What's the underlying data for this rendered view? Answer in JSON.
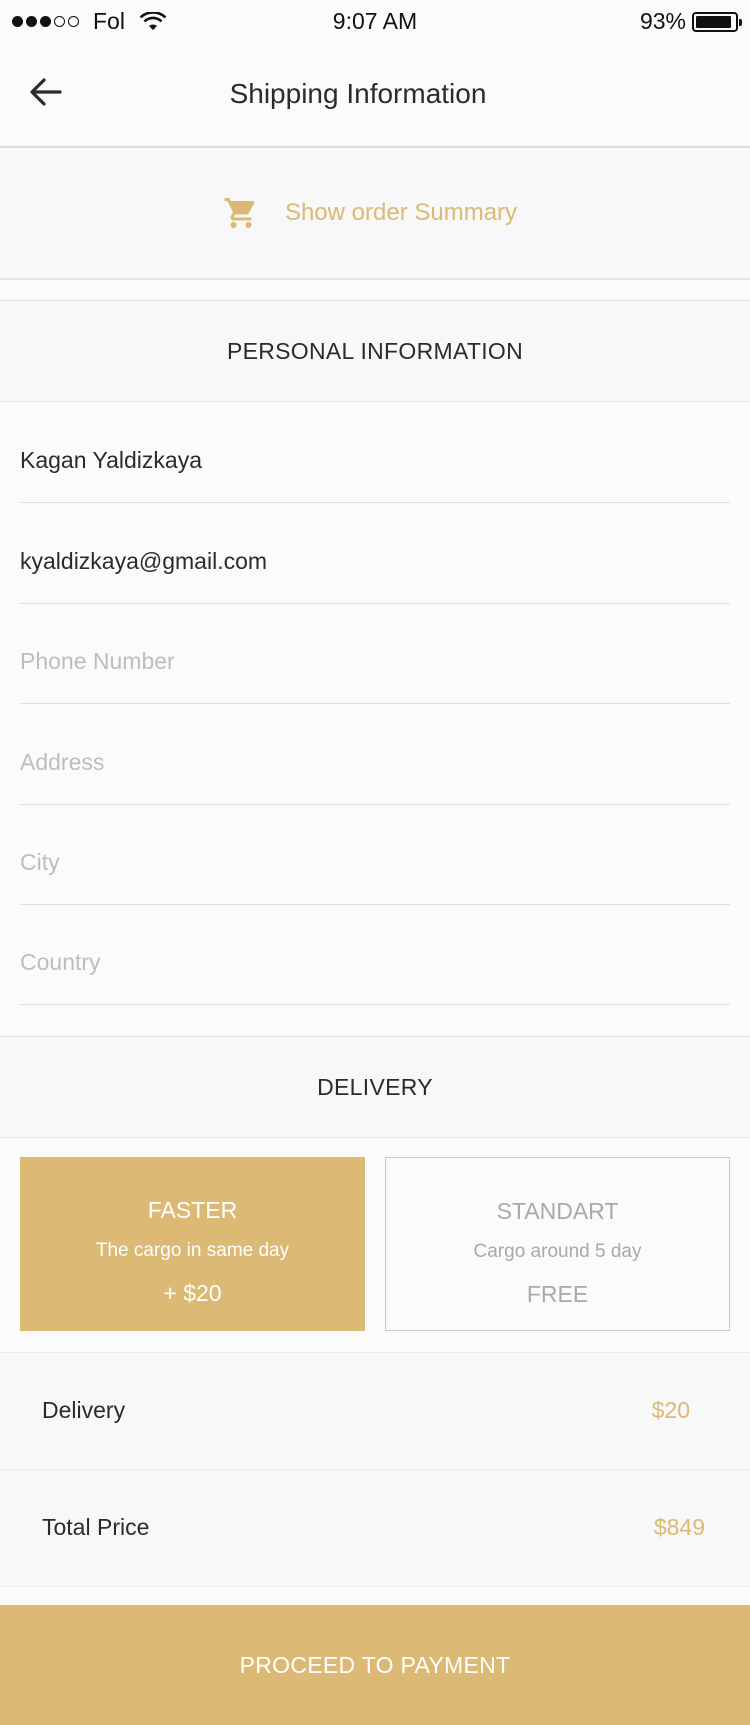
{
  "status_bar": {
    "carrier": "Fol",
    "time": "9:07 AM",
    "battery_percent": "93%",
    "signal_bars": 3,
    "signal_total": 5
  },
  "header": {
    "title": "Shipping Information",
    "back_icon": "arrow-left-icon"
  },
  "order_summary": {
    "icon": "cart-icon",
    "label": "Show order Summary"
  },
  "personal_info": {
    "header": "PERSONAL INFORMATION",
    "fields": [
      {
        "name": "full-name",
        "value": "Kagan Yaldizkaya",
        "placeholder": ""
      },
      {
        "name": "email",
        "value": "kyaldizkaya@gmail.com",
        "placeholder": ""
      },
      {
        "name": "phone",
        "value": "",
        "placeholder": "Phone Number"
      },
      {
        "name": "address",
        "value": "",
        "placeholder": "Address"
      },
      {
        "name": "city",
        "value": "",
        "placeholder": "City"
      },
      {
        "name": "country",
        "value": "",
        "placeholder": "Country"
      }
    ]
  },
  "delivery": {
    "header": "DELIVERY",
    "options": [
      {
        "title": "FASTER",
        "description": "The cargo in same day",
        "price": "+ $20",
        "selected": true
      },
      {
        "title": "STANDART",
        "description": "Cargo around 5 day",
        "price": "FREE",
        "selected": false
      }
    ]
  },
  "summary": {
    "delivery_label": "Delivery",
    "delivery_value": "$20",
    "total_label": "Total Price",
    "total_value": "$849"
  },
  "footer": {
    "proceed_label": "PROCEED TO PAYMENT"
  },
  "colors": {
    "accent": "#dcb974",
    "text": "#2b2b2b",
    "placeholder": "#bdbdbd",
    "background": "#fbfbfb"
  }
}
